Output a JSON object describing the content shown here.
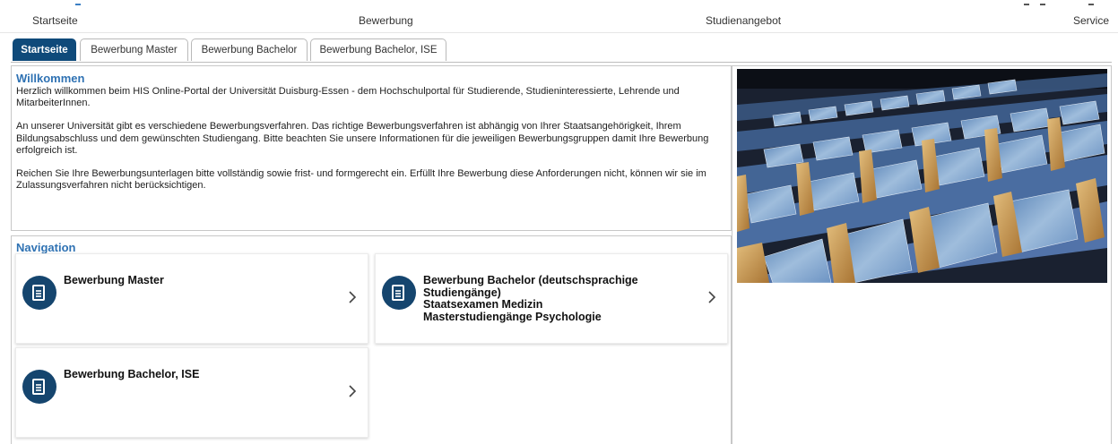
{
  "topnav": {
    "items": [
      "Startseite",
      "Bewerbung",
      "Studienangebot",
      "Service"
    ]
  },
  "tabs": [
    {
      "label": "Startseite",
      "active": true
    },
    {
      "label": "Bewerbung Master",
      "active": false
    },
    {
      "label": "Bewerbung Bachelor",
      "active": false
    },
    {
      "label": "Bewerbung Bachelor, ISE",
      "active": false
    }
  ],
  "welcome": {
    "title": "Willkommen",
    "paragraphs": [
      "Herzlich willkommen beim HIS Online-Portal der Universität Duisburg-Essen - dem Hochschulportal für Studierende, Studieninteressierte, Lehrende und MitarbeiterInnen.",
      "An unserer Universität gibt es verschiedene Bewerbungsverfahren. Das richtige Bewerbungsverfahren ist abhängig von Ihrer Staatsangehörigkeit, Ihrem Bildungsabschluss und dem gewünschten Studiengang. Bitte beachten Sie unsere Informationen für die jeweiligen Bewerbungsgruppen damit Ihre Bewerbung erfolgreich ist.",
      "Reichen Sie Ihre Bewerbungsunterlagen bitte vollständig sowie frist- und formgerecht ein. Erfüllt Ihre Bewerbung diese Anforderungen nicht, können wir sie im Zulassungsverfahren nicht berücksichtigen."
    ]
  },
  "navigation": {
    "title": "Navigation",
    "cards": [
      {
        "lines": [
          "Bewerbung Master"
        ],
        "icon": "document-icon",
        "chevron": ">"
      },
      {
        "lines": [
          "Bewerbung Bachelor (deutschsprachige",
          "Studiengänge)",
          "Staatsexamen Medizin",
          "Masterstudiengänge Psychologie"
        ],
        "icon": "document-icon",
        "chevron": ">"
      },
      {
        "lines": [
          "Bewerbung Bachelor, ISE"
        ],
        "icon": "document-icon",
        "chevron": ">"
      }
    ]
  },
  "colors": {
    "accent": "#0f4a7a",
    "title_blue": "#2f72b3",
    "icon_circle": "#15456e"
  },
  "image": {
    "subject": "lecture-hall-photo"
  }
}
